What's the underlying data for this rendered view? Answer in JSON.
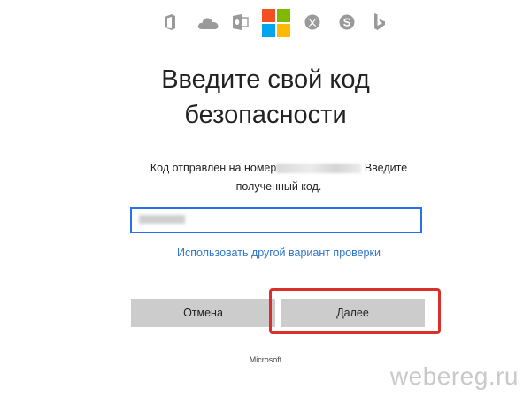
{
  "header": {
    "icons": [
      "office-icon",
      "onedrive-icon",
      "outlook-icon",
      "microsoft-logo-icon",
      "xbox-icon",
      "skype-icon",
      "bing-icon"
    ]
  },
  "title": {
    "line1": "Введите свой код",
    "line2": "безопасности"
  },
  "description": {
    "prefix": "Код отправлен на номер",
    "suffix": "Введите",
    "line2": "полученный код."
  },
  "code_field": {
    "value": ""
  },
  "alt_link": "Использовать другой вариант проверки",
  "buttons": {
    "cancel": "Отмена",
    "next": "Далее"
  },
  "footer": {
    "brand": "Microsoft"
  },
  "watermark": "webereg.ru",
  "colors": {
    "link": "#2e74c9",
    "input_border": "#2672ec",
    "button_bg": "#cccccc",
    "highlight": "#d9302c"
  }
}
